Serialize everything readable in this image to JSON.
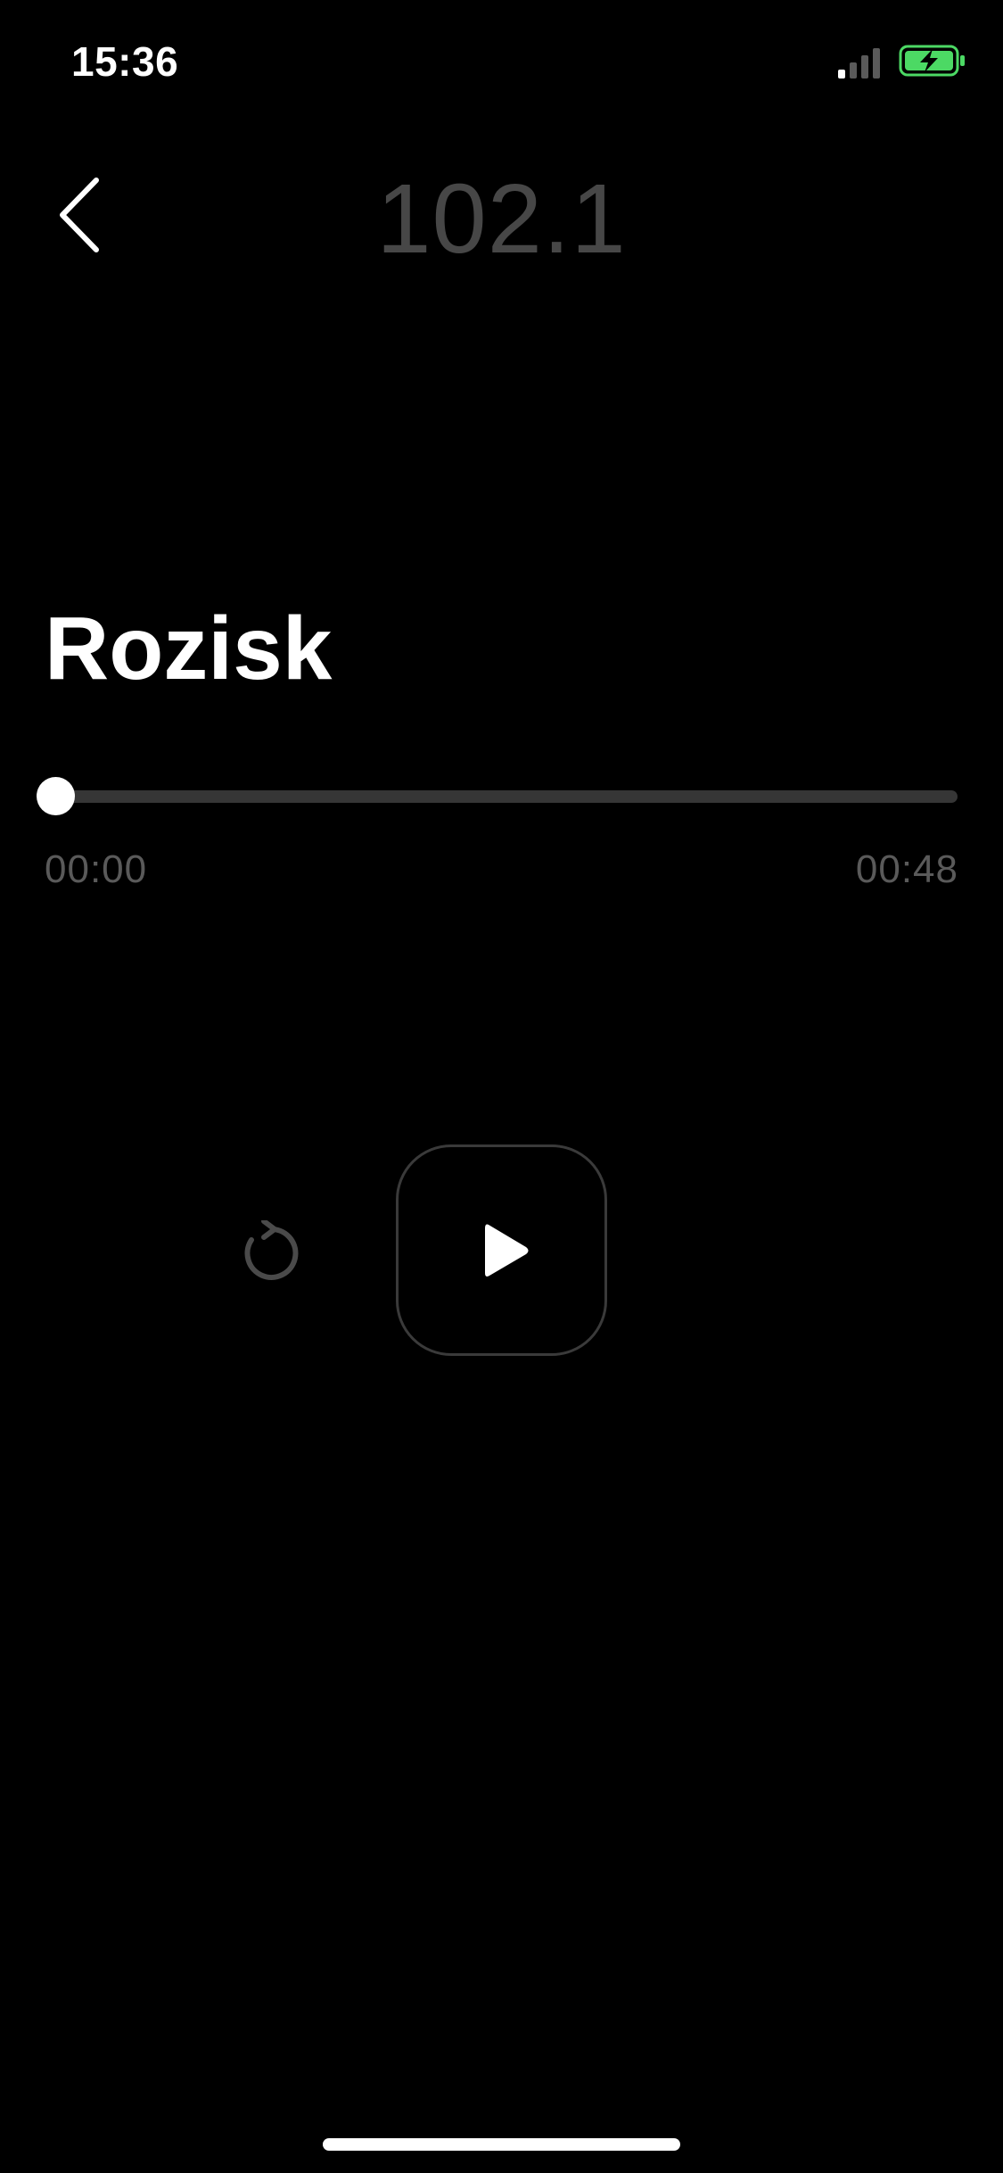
{
  "status_bar": {
    "time": "15:36",
    "signal_icon": "cellular-signal-icon",
    "battery_icon": "battery-charging-icon",
    "battery_color": "#4cd964"
  },
  "header": {
    "back_icon": "chevron-left-icon",
    "station": "102.1"
  },
  "track": {
    "title": "Rozisk",
    "progress": 0,
    "current_time": "00:00",
    "total_time": "00:48"
  },
  "controls": {
    "replay_icon": "replay-icon",
    "play_icon": "play-icon"
  },
  "colors": {
    "background": "#000000",
    "title_dim": "#474747",
    "track_bar": "#363636",
    "time_text": "#5a5a5a"
  }
}
